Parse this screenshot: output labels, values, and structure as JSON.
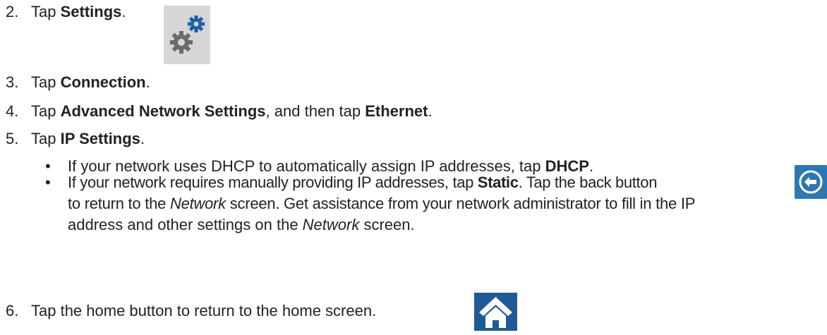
{
  "steps": {
    "s2": {
      "num": "2.",
      "pre": "Tap ",
      "bold": "Settings",
      "post": "."
    },
    "s3": {
      "num": "3.",
      "pre": "Tap ",
      "bold": "Connection",
      "post": "."
    },
    "s4": {
      "num": "4.",
      "pre": "Tap ",
      "bold1": "Advanced Network Settings",
      "mid": ", and then tap ",
      "bold2": "Ethernet",
      "post": "."
    },
    "s5": {
      "num": "5.",
      "pre": "Tap ",
      "bold": "IP Settings",
      "post": "."
    },
    "b1": {
      "bullet": "•",
      "pre": "If your network uses DHCP to automatically assign IP addresses, tap ",
      "bold": "DHCP",
      "post": "."
    },
    "b2": {
      "bullet": "•",
      "l1_pre": "If your network requires manually providing IP addresses, tap ",
      "l1_bold": "Static",
      "l1_post": ". Tap the back button",
      "l2_pre": "to return to the ",
      "l2_ital": "Network",
      "l2_post": " screen. Get assistance from your network administrator to fill in the IP",
      "l3_pre": "address and other settings on the ",
      "l3_ital": "Network",
      "l3_post": " screen."
    },
    "s6": {
      "num": "6.",
      "text": "Tap the home button to return to the home screen."
    }
  },
  "icons": {
    "settings": "settings-gears-icon",
    "back": "back-arrow-icon",
    "home": "home-icon"
  },
  "colors": {
    "settings_bg": "#d6d6d6",
    "gear_gray": "#6a6a6a",
    "gear_blue": "#1f5fa8",
    "back_bg": "#2e77b0",
    "home_bg": "#1f5a96"
  }
}
